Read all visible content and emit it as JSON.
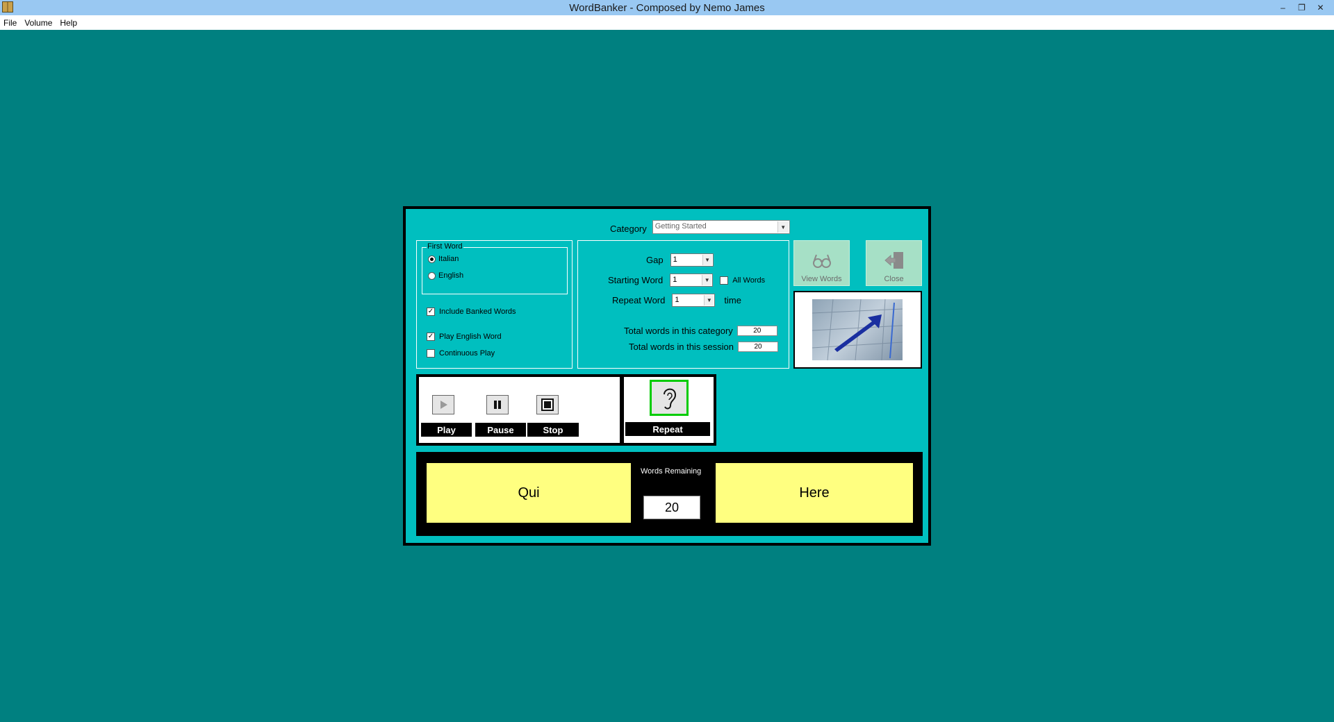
{
  "window": {
    "title": "WordBanker - Composed by Nemo James",
    "controls": [
      "–",
      "❐",
      "✕"
    ]
  },
  "menu": [
    "File",
    "Volume",
    "Help"
  ],
  "category": {
    "label": "Category",
    "value": "Getting Started"
  },
  "first_word": {
    "title": "First Word",
    "options": [
      "Italian",
      "English"
    ],
    "selected": "Italian"
  },
  "checkboxes": [
    {
      "label": "Include Banked Words",
      "checked": true
    },
    {
      "label": "Play English Word",
      "checked": true
    },
    {
      "label": "Continuous Play",
      "checked": false
    }
  ],
  "settings": {
    "gap": {
      "label": "Gap",
      "value": "1"
    },
    "starting_word": {
      "label": "Starting Word",
      "value": "1"
    },
    "all_words": {
      "label": "All Words",
      "checked": false
    },
    "repeat_word": {
      "label": "Repeat Word",
      "value": "1",
      "suffix": "time"
    },
    "total_category": {
      "label": "Total words in this category",
      "value": "20"
    },
    "total_session": {
      "label": "Total words in this session",
      "value": "20"
    }
  },
  "buttons": {
    "view_words": "View Words",
    "close": "Close",
    "play": "Play",
    "pause": "Pause",
    "stop": "Stop",
    "repeat": "Repeat"
  },
  "words": {
    "italian": "Qui",
    "english": "Here",
    "remaining_label": "Words Remaining",
    "remaining": "20"
  },
  "colors": {
    "desktop": "#008080",
    "panel": "#00bfbf",
    "word_card": "#ffff80",
    "repeat_highlight": "#00cc00"
  }
}
